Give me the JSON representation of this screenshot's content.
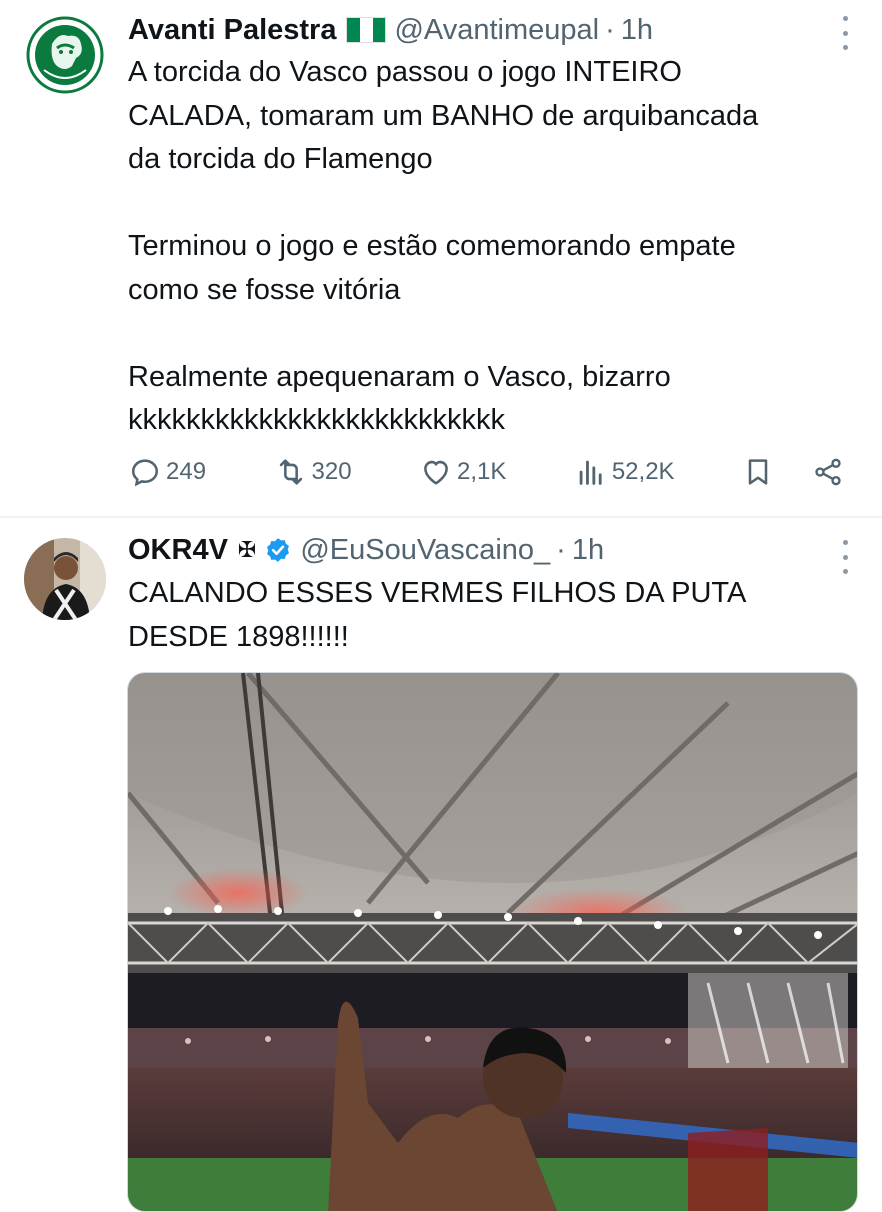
{
  "tweets": [
    {
      "name": "Avanti Palestra",
      "handle": "@Avantimeupal",
      "separator": "·",
      "time": "1h",
      "avatar_text": "AVANTE PALESTRA",
      "flag_icon": "nigeria-flag-icon",
      "paragraphs": [
        [
          "A torcida do Vasco passou o jogo INTEIRO",
          "CALADA, tomaram um BANHO de arquibancada",
          "da torcida do Flamengo"
        ],
        [
          "Terminou o jogo e estão comemorando empate",
          "como se fosse vitória"
        ],
        [
          "Realmente apequenaram o Vasco, bizarro",
          "kkkkkkkkkkkkkkkkkkkkkkkkkk"
        ]
      ],
      "actions": {
        "replies": "249",
        "retweets": "320",
        "likes": "2,1K",
        "views": "52,2K"
      }
    },
    {
      "name": "OKR4V",
      "name_symbol": "✠",
      "handle": "@EuSouVascaino_",
      "separator": "·",
      "time": "1h",
      "verified": true,
      "lines": [
        "CALANDO ESSES VERMES FILHOS DA PUTA",
        "DESDE 1898!!!!!!"
      ]
    }
  ],
  "colors": {
    "text": "#0f1419",
    "secondary": "#536471",
    "verified": "#1d9bf0",
    "divider": "#eff3f4"
  }
}
